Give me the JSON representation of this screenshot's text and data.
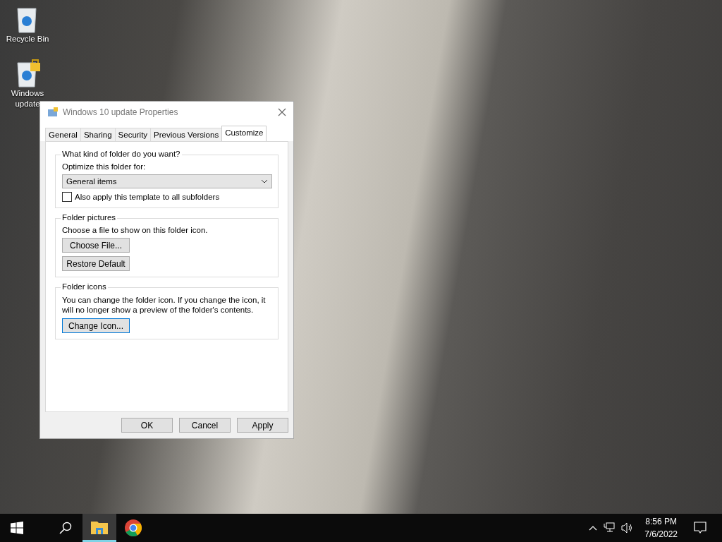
{
  "desktop_icons": [
    {
      "kind": "recycle",
      "lines": [
        "Recycle Bin"
      ]
    },
    {
      "kind": "locked",
      "lines": [
        "Windows",
        "update"
      ]
    }
  ],
  "properties_dialog": {
    "title": "Windows 10 update Properties",
    "tabs": [
      {
        "label": "General",
        "selected": false
      },
      {
        "label": "Sharing",
        "selected": false
      },
      {
        "label": "Security",
        "selected": false
      },
      {
        "label": "Previous Versions",
        "selected": false
      },
      {
        "label": "Customize",
        "selected": true
      }
    ],
    "folder_kind": {
      "heading": "What kind of folder do you want?",
      "optimize_label": "Optimize this folder for:",
      "optimize_value": "General items",
      "subfolders": {
        "label": "Also apply this template to all subfolders",
        "checked": false
      }
    },
    "folder_pictures": {
      "heading": "Folder pictures",
      "text": "Choose a file to show on this folder icon.",
      "buttons": [
        "Choose File...",
        "Restore Default"
      ]
    },
    "folder_icons": {
      "heading": "Folder icons",
      "text": "You can change the folder icon. If you change the icon, it will no longer show a preview of the folder's contents.",
      "button": "Change Icon..."
    },
    "buttons": [
      "OK",
      "Cancel",
      "Apply"
    ]
  },
  "taskbar": {
    "apps": [
      {
        "kind": "explorer",
        "selected": true
      },
      {
        "kind": "chrome",
        "selected": false
      }
    ],
    "time": "8:56 PM",
    "date": "7/6/2022"
  }
}
